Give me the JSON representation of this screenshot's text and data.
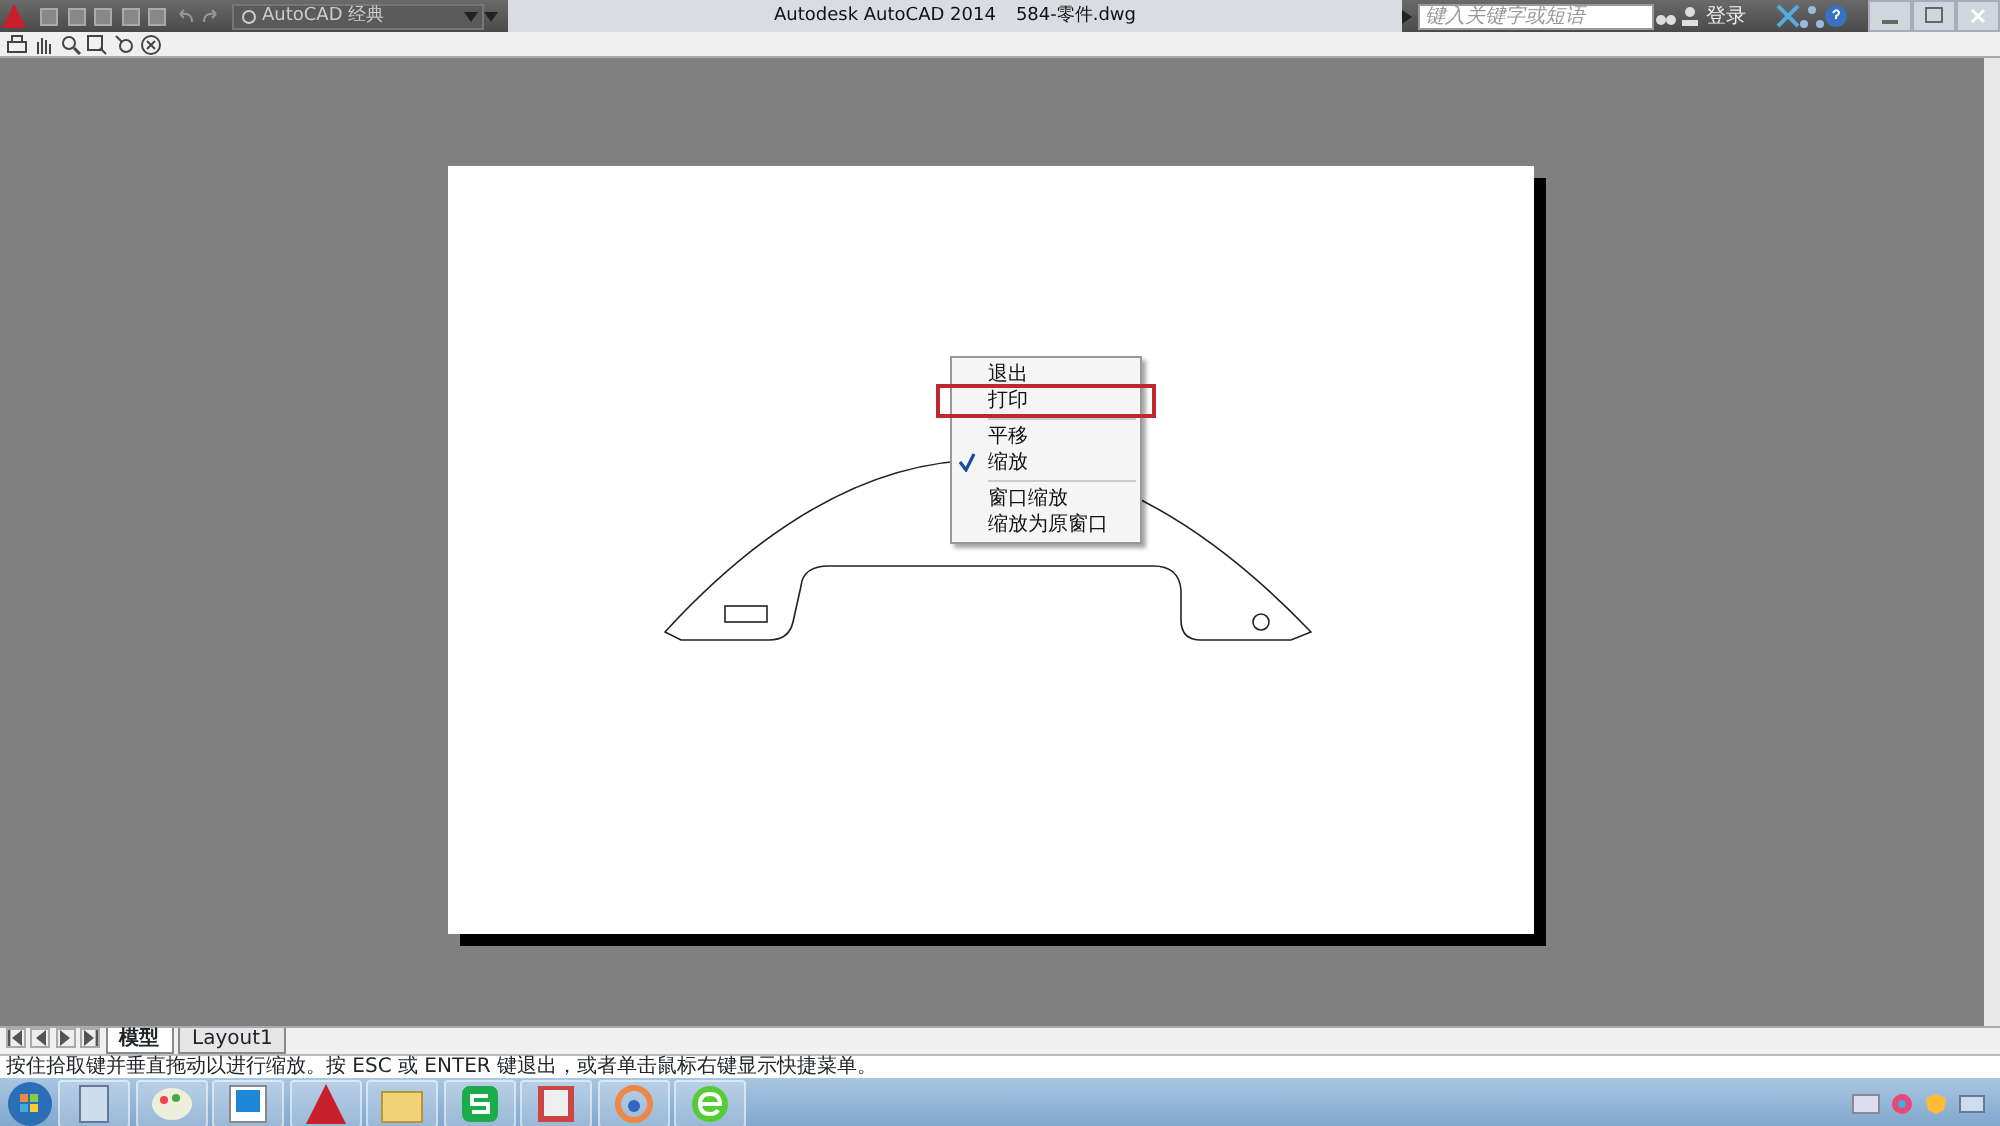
{
  "title_bar": {
    "workspace": "AutoCAD 经典",
    "app_title": "Autodesk AutoCAD 2014",
    "file_name": "584-零件.dwg",
    "search": {
      "placeholder": "键入关键字或短语"
    },
    "login": "登录"
  },
  "context_menu": {
    "items": [
      {
        "kind": "item",
        "label": "退出",
        "checked": false,
        "highlighted": false
      },
      {
        "kind": "item",
        "label": "打印",
        "checked": false,
        "highlighted": true
      },
      {
        "kind": "separator"
      },
      {
        "kind": "item",
        "label": "平移",
        "checked": false,
        "highlighted": false
      },
      {
        "kind": "item",
        "label": "缩放",
        "checked": true,
        "highlighted": false
      },
      {
        "kind": "separator"
      },
      {
        "kind": "item",
        "label": "窗口缩放",
        "checked": false,
        "highlighted": false
      },
      {
        "kind": "item",
        "label": "缩放为原窗口",
        "checked": false,
        "highlighted": false
      }
    ]
  },
  "layout_tabs": [
    {
      "label": "模型",
      "selected": true
    },
    {
      "label": "Layout1",
      "selected": false
    }
  ],
  "command_line": "按住拾取键并垂直拖动以进行缩放。按 ESC 或 ENTER 键退出，或者单击鼠标右键显示快捷菜单。"
}
